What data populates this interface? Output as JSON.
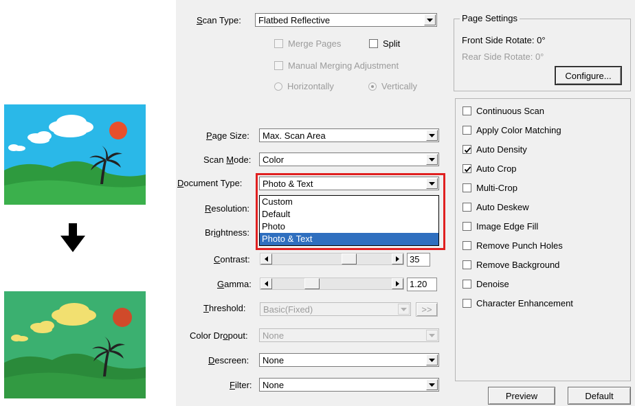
{
  "panel": {
    "scan_type": {
      "label_u": "S",
      "label_rest": "can Type:",
      "value": "Flatbed Reflective"
    },
    "merge_pages": "Merge Pages",
    "split": "Split",
    "manual_merging": "Manual Merging Adjustment",
    "horizontally": "Horizontally",
    "vertically": "Vertically",
    "page_settings": {
      "title": "Page Settings",
      "front": "Front Side Rotate: 0°",
      "rear": "Rear Side Rotate: 0°",
      "configure": "Configure..."
    },
    "page_size": {
      "label_u": "P",
      "label_rest": "age Size:",
      "value": "Max. Scan Area"
    },
    "scan_mode": {
      "label_pre": "Scan ",
      "label_u": "M",
      "label_rest": "ode:",
      "value": "Color"
    },
    "document_type": {
      "label_u": "D",
      "label_rest": "ocument Type:",
      "value": "Photo & Text",
      "options": [
        "Custom",
        "Default",
        "Photo",
        "Photo & Text"
      ]
    },
    "resolution": {
      "label_u": "R",
      "label_rest": "esolution:"
    },
    "brightness": {
      "label_pre": "Br",
      "label_u": "i",
      "label_rest": "ghtness:"
    },
    "contrast": {
      "label_u": "C",
      "label_rest": "ontrast:",
      "value": "35",
      "level": 35
    },
    "gamma": {
      "label_u": "G",
      "label_rest": "amma:",
      "value": "1.20",
      "level": 1.2
    },
    "threshold": {
      "label_u": "T",
      "label_rest": "hreshold:",
      "value": "Basic(Fixed)",
      "more": ">>"
    },
    "color_dropout": {
      "label_pre": "Color Dr",
      "label_u": "o",
      "label_rest": "pout:",
      "value": "None"
    },
    "descreen": {
      "label_u": "D",
      "label_rest": "escreen:",
      "value": "None"
    },
    "filter": {
      "label_u": "F",
      "label_rest": "ilter:",
      "value": "None"
    },
    "options": [
      {
        "label": "Continuous Scan",
        "checked": false
      },
      {
        "label": "Apply Color Matching",
        "checked": false
      },
      {
        "label": "Auto Density",
        "checked": true
      },
      {
        "label": "Auto Crop",
        "checked": true
      },
      {
        "label": "Multi-Crop",
        "checked": false
      },
      {
        "label": "Auto Deskew",
        "checked": false
      },
      {
        "label": "Image Edge Fill",
        "checked": false
      },
      {
        "label": "Remove Punch Holes",
        "checked": false
      },
      {
        "label": "Remove Background",
        "checked": false
      },
      {
        "label": "Denoise",
        "checked": false
      },
      {
        "label": "Character Enhancement",
        "checked": false
      }
    ],
    "preview": "Preview",
    "default": "Default"
  },
  "colors": {
    "highlight": "#e02020",
    "selection": "#2f6fbf",
    "panel_bg": "#f0f0f0"
  }
}
